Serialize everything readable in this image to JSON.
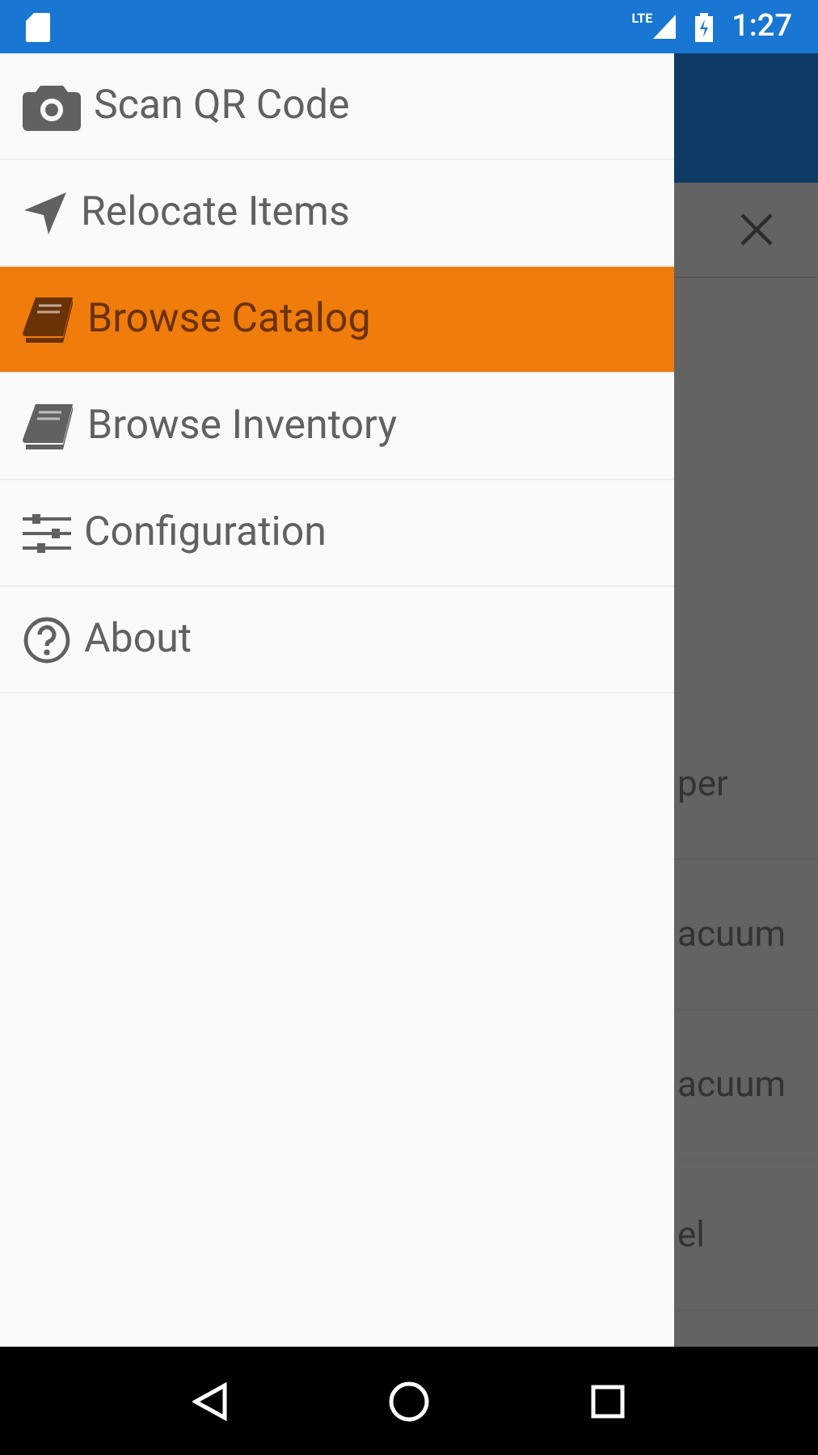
{
  "status_bar": {
    "time": "1:27",
    "network": "LTE"
  },
  "drawer": {
    "items": [
      {
        "label": "Scan QR Code",
        "kind": "camera",
        "selected": false
      },
      {
        "label": "Relocate Items",
        "kind": "navigate",
        "selected": false
      },
      {
        "label": "Browse Catalog",
        "kind": "book",
        "selected": true
      },
      {
        "label": "Browse Inventory",
        "kind": "book",
        "selected": false
      },
      {
        "label": "Configuration",
        "kind": "sliders",
        "selected": false
      },
      {
        "label": "About",
        "kind": "help",
        "selected": false
      }
    ]
  },
  "background_list": {
    "rows": [
      "per",
      "acuum",
      "acuum",
      "el"
    ]
  }
}
